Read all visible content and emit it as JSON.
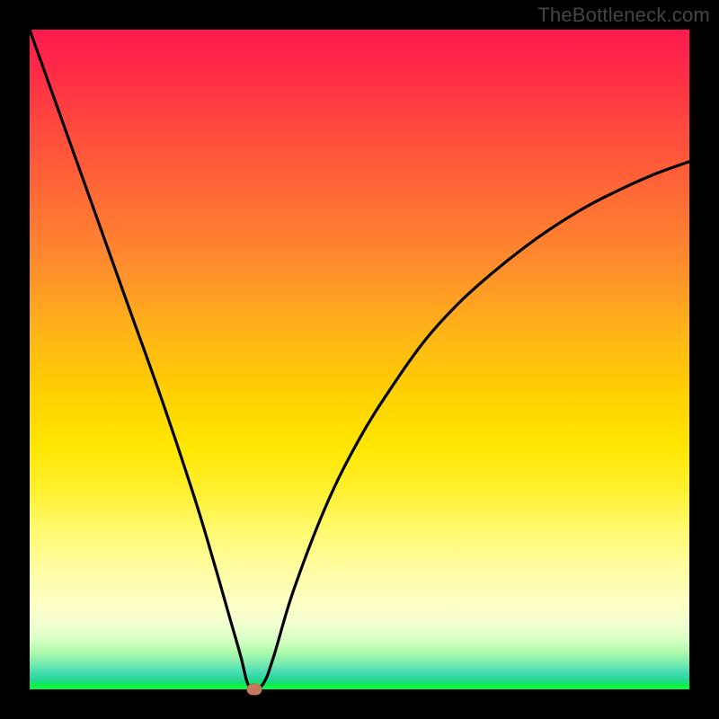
{
  "watermark": "TheBottleneck.com",
  "chart_data": {
    "type": "line",
    "title": "",
    "xlabel": "",
    "ylabel": "",
    "xlim": [
      0,
      100
    ],
    "ylim": [
      0,
      100
    ],
    "grid": false,
    "legend": false,
    "series": [
      {
        "name": "bottleneck-curve",
        "x": [
          0,
          5,
          10,
          15,
          20,
          25,
          28,
          30,
          32,
          33,
          34,
          35.5,
          37,
          40,
          45,
          50,
          55,
          60,
          65,
          70,
          75,
          80,
          85,
          90,
          95,
          100
        ],
        "y": [
          100,
          86,
          72,
          58,
          44,
          29,
          19,
          12,
          5,
          1,
          0,
          1,
          5,
          15,
          28,
          38,
          46,
          53,
          58.5,
          63,
          67,
          70.5,
          73.5,
          76,
          78.2,
          80
        ],
        "color": "#000000"
      }
    ],
    "marker": {
      "x": 34,
      "y": 0,
      "color": "#c47860"
    },
    "background_gradient": {
      "top": "#ff1a4d",
      "mid": "#ffe600",
      "bottom": "#06ff2e"
    }
  }
}
